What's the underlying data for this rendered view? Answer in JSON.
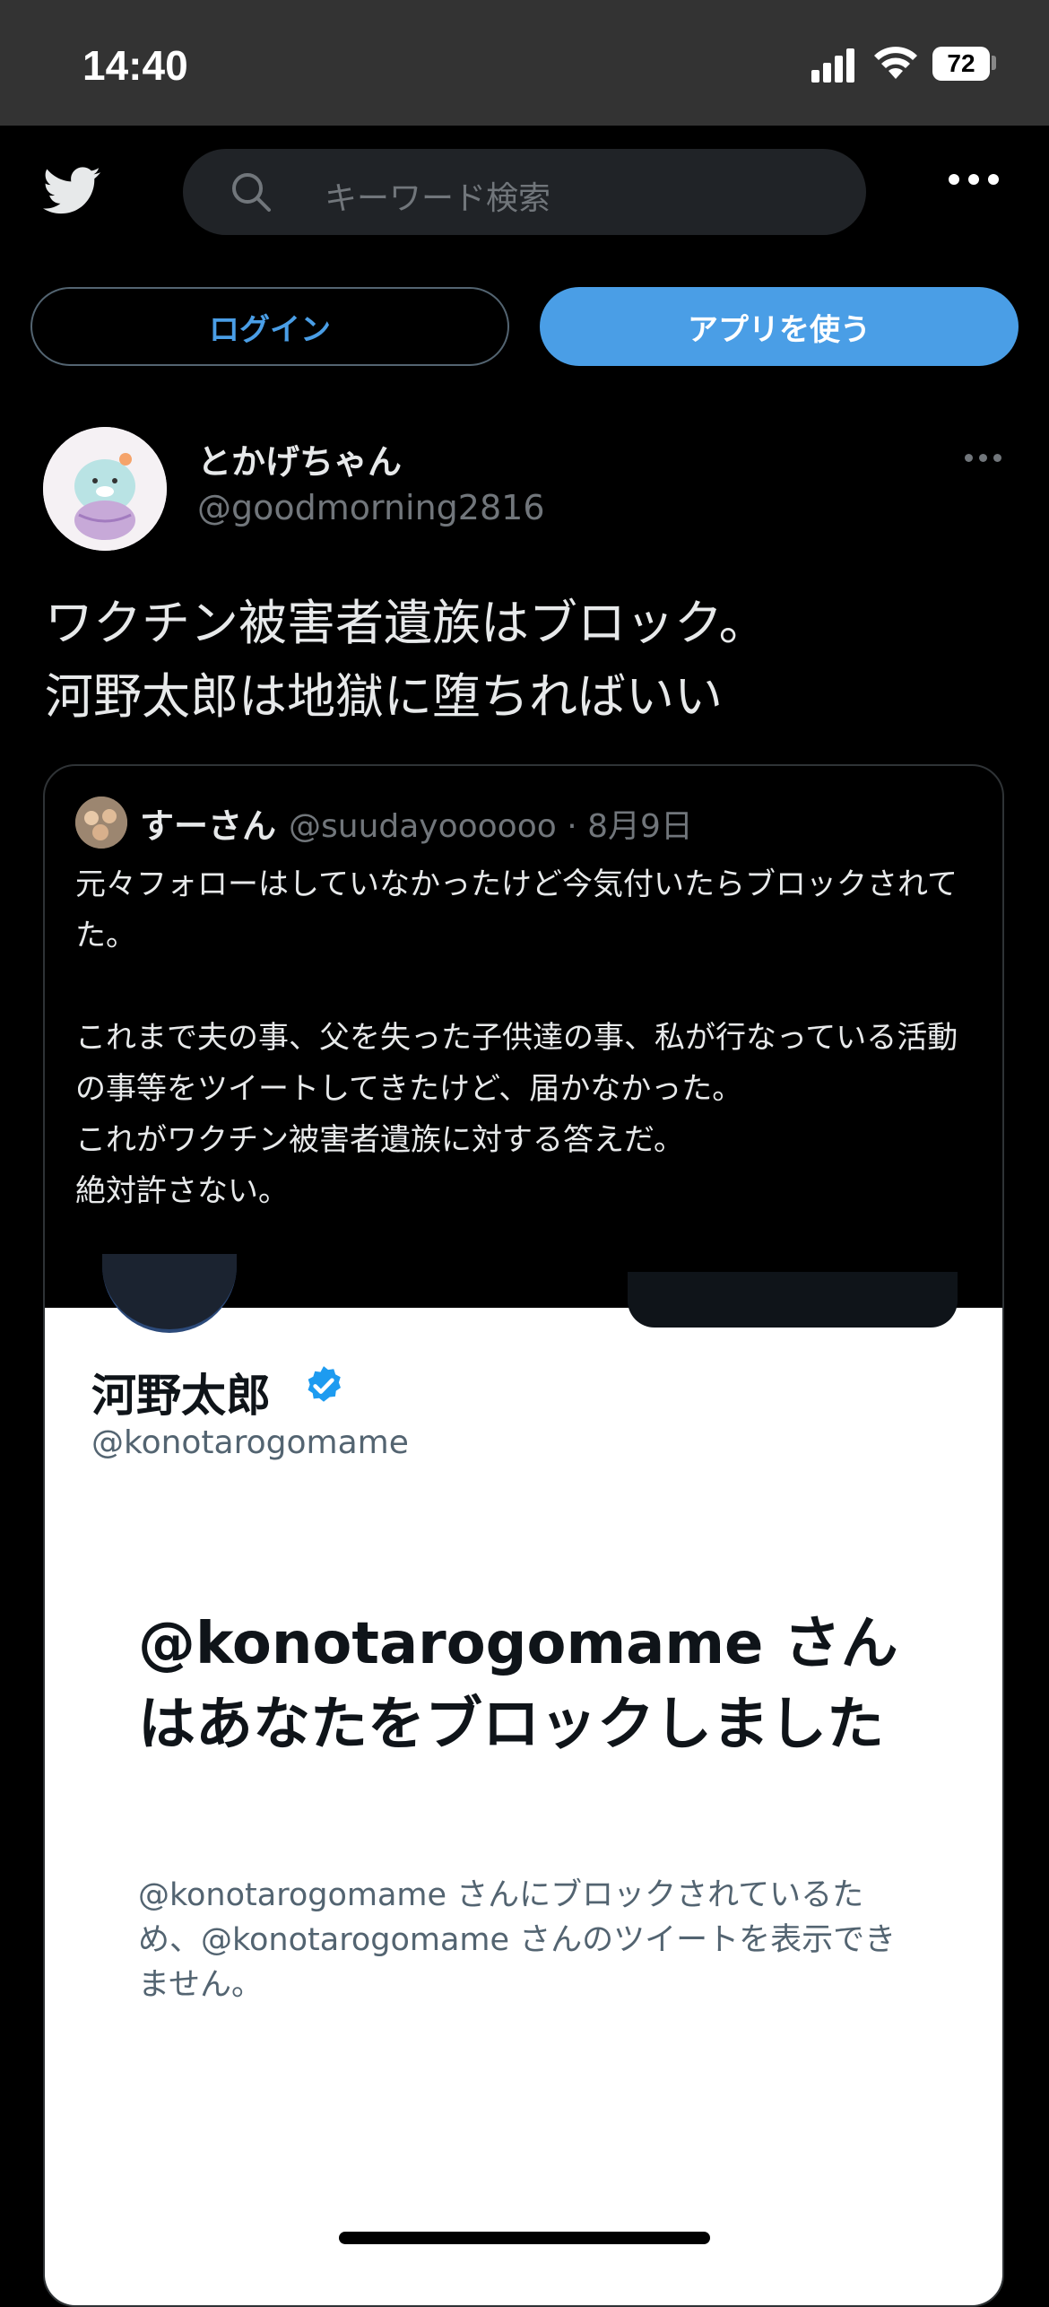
{
  "status_bar": {
    "time": "14:40",
    "battery": "72"
  },
  "nav": {
    "search_placeholder": "キーワード検索"
  },
  "buttons": {
    "login": "ログイン",
    "use_app": "アプリを使う"
  },
  "tweet": {
    "display_name": "とかげちゃん",
    "handle": "@goodmorning2816",
    "text": "ワクチン被害者遺族はブロック。\n河野太郎は地獄に堕ちればいい"
  },
  "quote": {
    "display_name": "すーさん",
    "handle_date": "@suudayoooooo · 8月9日",
    "text": "元々フォローはしていなかったけど今気付いたらブロックされてた。\n\nこれまで夫の事、父を失った子供達の事、私が行なっている活動の事等をツイートしてきたけど、届かなかった。\nこれがワクチン被害者遺族に対する答えだ。\n絶対許さない。",
    "screenshot": {
      "name": "河野太郎",
      "handle": "@konotarogomame",
      "title": "@konotarogomame さんはあなたをブロックしました",
      "description": "@konotarogomame さんにブロックされているため、@konotarogomame さんのツイートを表示できません。"
    }
  },
  "colors": {
    "accent": "#4a9ee6",
    "background": "#000000",
    "status_bar": "#333333"
  }
}
